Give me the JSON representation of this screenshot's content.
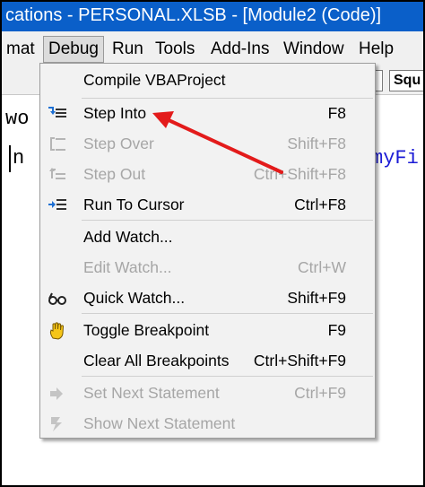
{
  "window": {
    "title": "cations - PERSONAL.XLSB - [Module2 (Code)]"
  },
  "menubar": {
    "items": [
      {
        "id": "format",
        "label": "mat"
      },
      {
        "id": "debug",
        "label": "Debug"
      },
      {
        "id": "run",
        "label": "Run"
      },
      {
        "id": "tools",
        "label": "Tools"
      },
      {
        "id": "addins",
        "label": "Add-Ins"
      },
      {
        "id": "window",
        "label": "Window"
      },
      {
        "id": "help",
        "label": "Help"
      }
    ]
  },
  "toolbar": {
    "procedure_combo": "Squ"
  },
  "code_fragments": {
    "line1": "wo",
    "line2": "n",
    "line2_right": "myFi"
  },
  "debug_menu": {
    "items": [
      {
        "label": "Compile VBAProject",
        "shortcut": "",
        "enabled": true,
        "icon": ""
      },
      {
        "label": "Step Into",
        "shortcut": "F8",
        "enabled": true,
        "icon": "step-into-icon"
      },
      {
        "label": "Step Over",
        "shortcut": "Shift+F8",
        "enabled": false,
        "icon": "step-over-icon"
      },
      {
        "label": "Step Out",
        "shortcut": "Ctrl+Shift+F8",
        "enabled": false,
        "icon": "step-out-icon"
      },
      {
        "label": "Run To Cursor",
        "shortcut": "Ctrl+F8",
        "enabled": true,
        "icon": "run-to-cursor-icon"
      },
      {
        "label": "Add Watch...",
        "shortcut": "",
        "enabled": true,
        "icon": ""
      },
      {
        "label": "Edit Watch...",
        "shortcut": "Ctrl+W",
        "enabled": false,
        "icon": ""
      },
      {
        "label": "Quick Watch...",
        "shortcut": "Shift+F9",
        "enabled": true,
        "icon": "glasses-icon"
      },
      {
        "label": "Toggle Breakpoint",
        "shortcut": "F9",
        "enabled": true,
        "icon": "hand-icon"
      },
      {
        "label": "Clear All Breakpoints",
        "shortcut": "Ctrl+Shift+F9",
        "enabled": true,
        "icon": ""
      },
      {
        "label": "Set Next Statement",
        "shortcut": "Ctrl+F9",
        "enabled": false,
        "icon": "set-next-arrow-icon"
      },
      {
        "label": "Show Next Statement",
        "shortcut": "",
        "enabled": false,
        "icon": "show-next-icon"
      }
    ]
  },
  "colors": {
    "titlebar": "#0a5fc9",
    "menu_bg": "#f2f2f2",
    "disabled_text": "#a6a6a6",
    "annotation_arrow": "#e31b1b"
  }
}
